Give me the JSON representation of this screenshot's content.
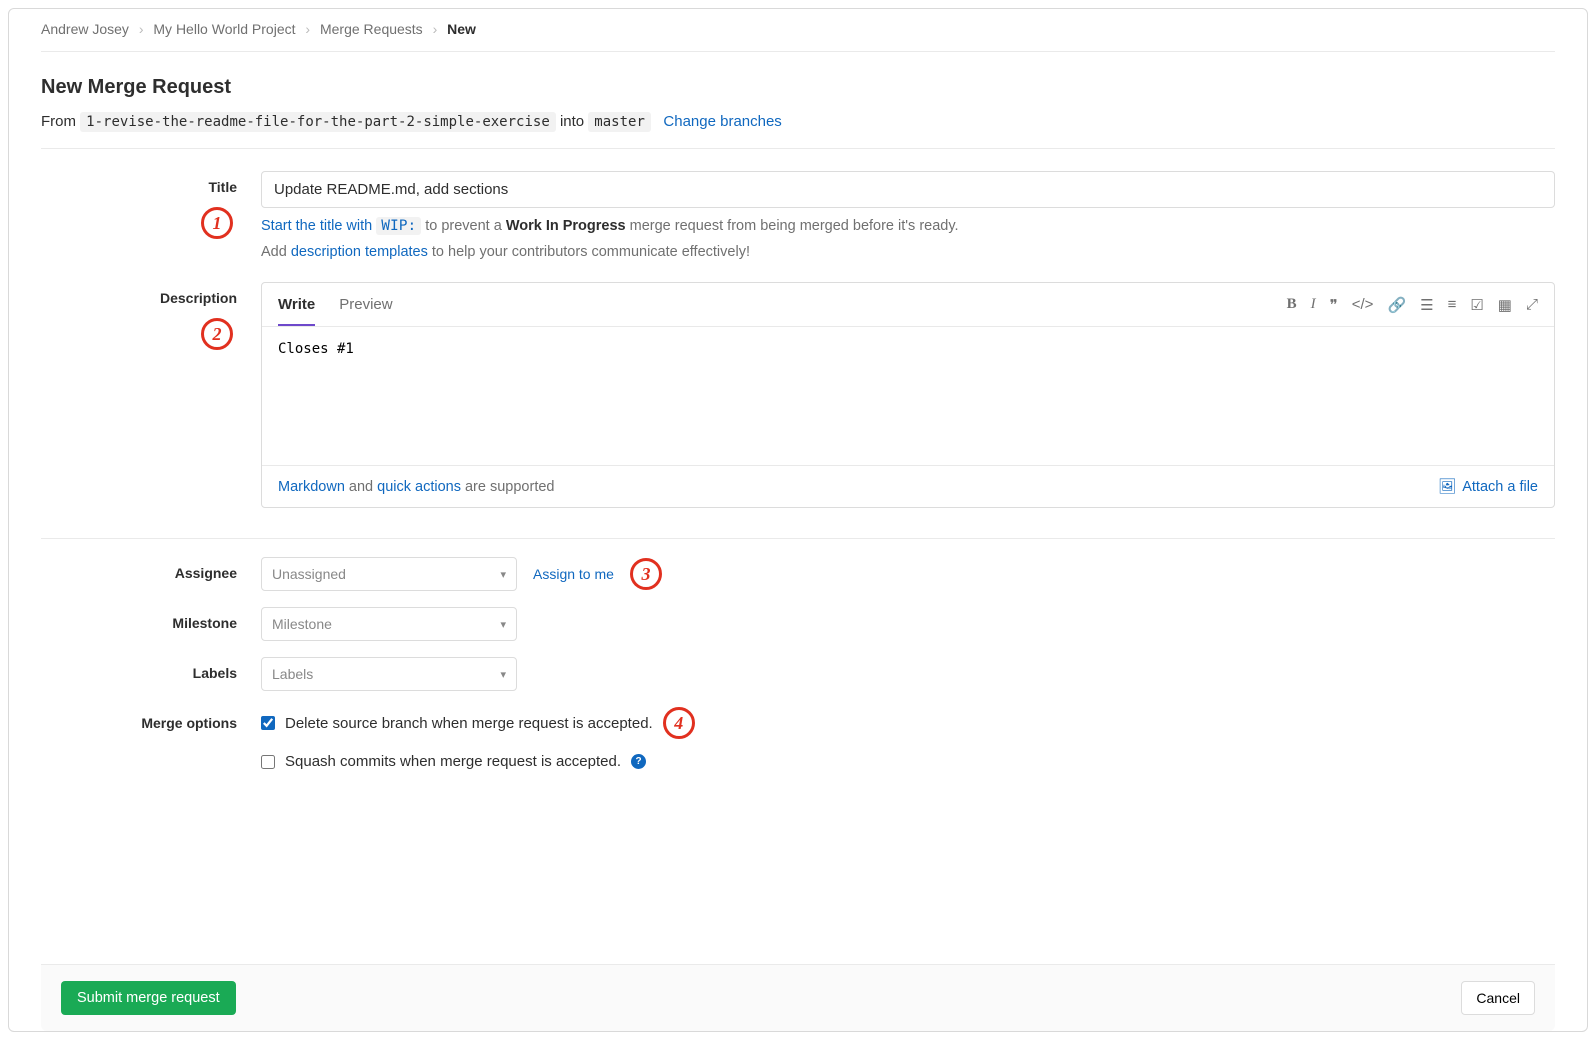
{
  "breadcrumb": {
    "items": [
      "Andrew Josey",
      "My Hello World Project",
      "Merge Requests"
    ],
    "current": "New"
  },
  "page_title": "New Merge Request",
  "from_into": {
    "from_label": "From",
    "source_branch": "1-revise-the-readme-file-for-the-part-2-simple-exercise",
    "into_label": "into",
    "target_branch": "master",
    "change_link": "Change branches"
  },
  "title_section": {
    "label": "Title",
    "value": "Update README.md, add sections",
    "hint_start": "Start the title with",
    "wip_code": "WIP:",
    "hint_mid": " to prevent a ",
    "hint_bold": "Work In Progress",
    "hint_end": " merge request from being merged before it's ready.",
    "hint2_pre": "Add ",
    "hint2_link": "description templates",
    "hint2_post": " to help your contributors communicate effectively!"
  },
  "description_section": {
    "label": "Description",
    "tabs": {
      "write": "Write",
      "preview": "Preview"
    },
    "value": "Closes #1",
    "footer_markdown": "Markdown",
    "footer_and": " and ",
    "footer_quick": "quick actions",
    "footer_supported": " are supported",
    "attach_label": "Attach a file"
  },
  "assignee": {
    "label": "Assignee",
    "placeholder": "Unassigned",
    "assign_me": "Assign to me"
  },
  "milestone": {
    "label": "Milestone",
    "placeholder": "Milestone"
  },
  "labels": {
    "label": "Labels",
    "placeholder": "Labels"
  },
  "merge_options": {
    "label": "Merge options",
    "opt_delete": "Delete source branch when merge request is accepted.",
    "opt_squash": "Squash commits when merge request is accepted."
  },
  "actions": {
    "submit": "Submit merge request",
    "cancel": "Cancel"
  },
  "callouts": {
    "c1": "1",
    "c2": "2",
    "c3": "3",
    "c4": "4"
  }
}
